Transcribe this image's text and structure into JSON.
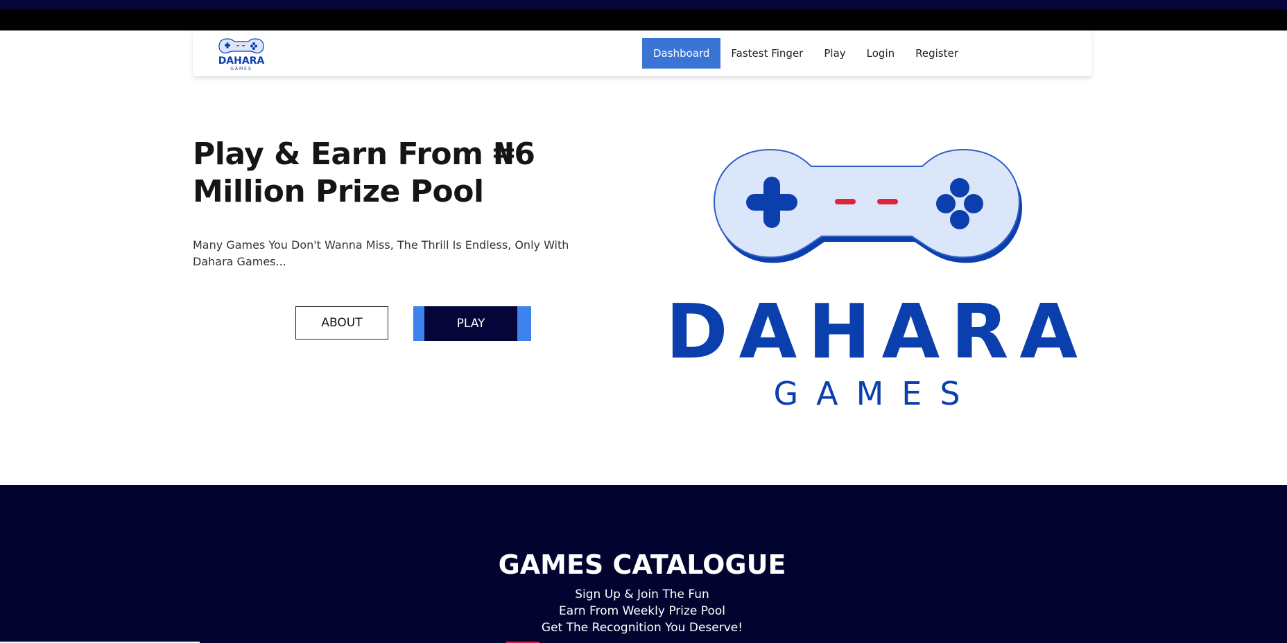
{
  "nav": {
    "logo": {
      "brand": "DAHARA",
      "sub": "GAMES"
    },
    "links": [
      {
        "label": "Dashboard",
        "active": true
      },
      {
        "label": "Fastest Finger",
        "active": false
      },
      {
        "label": "Play",
        "active": false
      },
      {
        "label": "Login",
        "active": false
      },
      {
        "label": "Register",
        "active": false
      }
    ]
  },
  "hero": {
    "title": "Play & Earn From ₦6 Million Prize Pool",
    "subtitle": "Many Games You Don't Wanna Miss, The Thrill Is Endless, Only With Dahara Games...",
    "about_label": "ABOUT",
    "play_label": "PLAY",
    "logo": {
      "brand": "DAHARA",
      "sub": "GAMES",
      "icon": "gamepad-icon"
    }
  },
  "catalogue": {
    "title": "GAMES CATALOGUE",
    "lines": [
      "Sign Up & Join The Fun",
      "Earn From Weekly Prize Pool",
      "Get The Recognition You Deserve!"
    ]
  },
  "colors": {
    "navy": "#05053a",
    "brand_blue": "#0b3fad",
    "active_nav": "#3a74d4",
    "play_accent": "#3e82ee",
    "dpad_red": "#e0253a"
  }
}
